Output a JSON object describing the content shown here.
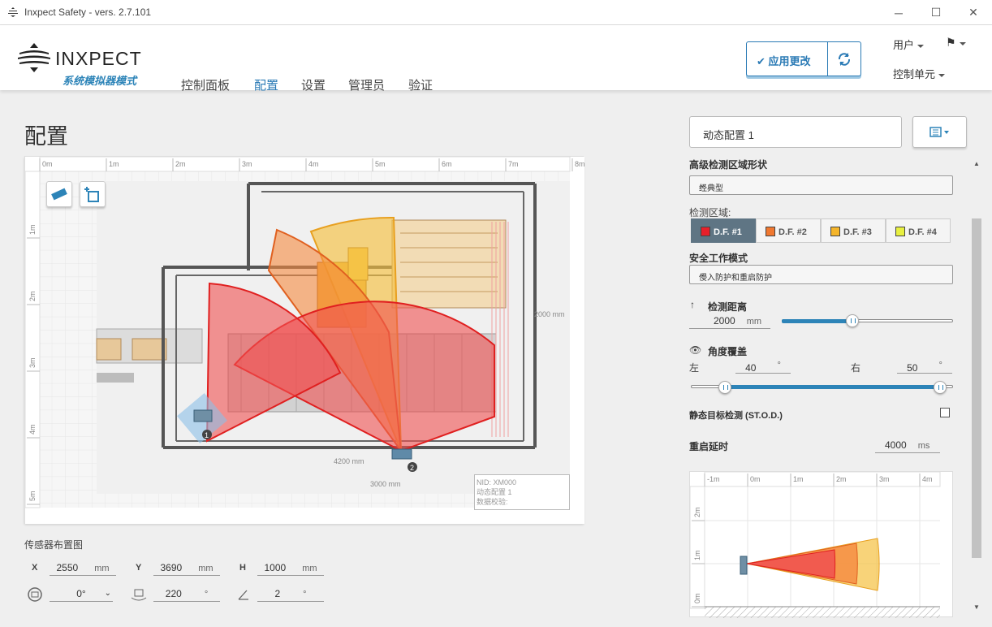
{
  "window": {
    "title": "Inxpect Safety - vers. 2.7.101",
    "minimize": "─",
    "maximize": "☐",
    "close": "✕"
  },
  "header": {
    "brand": "INXPECT",
    "mode": "系统模拟器模式",
    "nav": [
      "控制面板",
      "配置",
      "设置",
      "管理员",
      "验证"
    ],
    "active_nav": "配置",
    "apply_label": "应用更改",
    "user_menu": "用户",
    "control_unit_menu": "控制单元"
  },
  "page": {
    "title": "配置"
  },
  "map": {
    "ruler_x": [
      "0m",
      "1m",
      "2m",
      "3m",
      "4m",
      "5m",
      "6m",
      "7m",
      "8m"
    ],
    "ruler_y": [
      "1m",
      "2m",
      "3m",
      "4m",
      "5m"
    ],
    "dim_labels": [
      "4200 mm",
      "3000 mm",
      "2000 mm"
    ],
    "sensors": [
      "1",
      "2"
    ],
    "nid_box": [
      "NID: XM000",
      "动态配置 1",
      "数据校验:"
    ]
  },
  "sensor_placement": {
    "title": "传感器布置图",
    "x_label": "X",
    "x_value": "2550",
    "x_unit": "mm",
    "y_label": "Y",
    "y_value": "3690",
    "y_unit": "mm",
    "h_label": "H",
    "h_value": "1000",
    "h_unit": "mm",
    "rotation_value": "0°",
    "tilt_value": "220",
    "tilt_unit": "°",
    "angle_value": "2",
    "angle_unit": "°"
  },
  "config_panel": {
    "dynamic_config": "动态配置 1",
    "shape_label": "高级检测区域形状",
    "shape_value": "经典型",
    "field_label": "检测区域:",
    "fields": [
      {
        "label": "D.F. #1",
        "color": "#e8202a"
      },
      {
        "label": "D.F. #2",
        "color": "#f07830"
      },
      {
        "label": "D.F. #3",
        "color": "#f5b52a"
      },
      {
        "label": "D.F. #4",
        "color": "#e8f040"
      }
    ],
    "active_field": "D.F. #1",
    "safety_mode_label": "安全工作模式",
    "safety_mode_value": "侵入防护和重启防护",
    "distance_label": "检测距离",
    "distance_value": "2000",
    "distance_unit": "mm",
    "distance_fraction": 0.41,
    "angle_label": "角度覆盖",
    "left_label": "左",
    "left_value": "40",
    "left_unit": "°",
    "right_label": "右",
    "right_value": "50",
    "right_unit": "°",
    "stod_label": "静态目标检测 (ST.O.D.)",
    "restart_label": "重启延时",
    "restart_value": "4000",
    "restart_unit": "ms"
  },
  "side_view": {
    "ruler_x": [
      "-1m",
      "0m",
      "1m",
      "2m",
      "3m",
      "4m"
    ],
    "ruler_y": [
      "2m",
      "1m",
      "0m"
    ]
  },
  "colors": {
    "accent": "#2a7ab5",
    "df1": "#e8202a",
    "df2": "#f07830",
    "df3": "#f5b52a",
    "df4": "#e8f040"
  }
}
